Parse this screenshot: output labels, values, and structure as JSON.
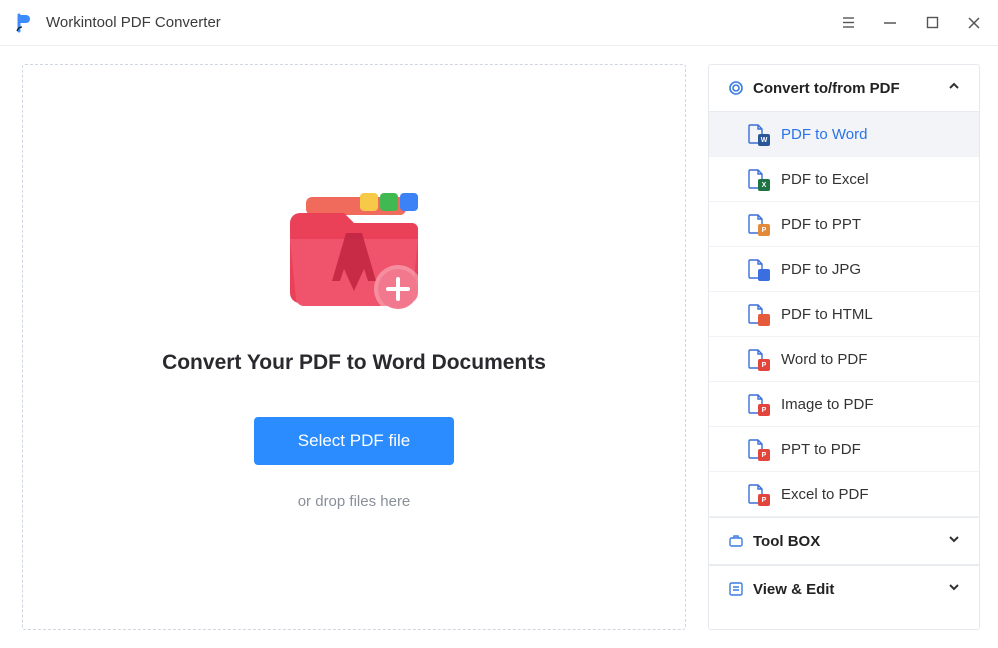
{
  "app": {
    "title": "Workintool PDF Converter"
  },
  "dropzone": {
    "headline": "Convert Your PDF to Word Documents",
    "select_button": "Select PDF file",
    "hint": "or drop files here"
  },
  "sidebar": {
    "sections": [
      {
        "title": "Convert to/from PDF",
        "expanded": true
      },
      {
        "title": "Tool BOX",
        "expanded": false
      },
      {
        "title": "View & Edit",
        "expanded": false
      }
    ],
    "convert_items": [
      {
        "label": "PDF to Word",
        "badge": "W",
        "badgeClass": "badge-word",
        "active": true
      },
      {
        "label": "PDF to Excel",
        "badge": "X",
        "badgeClass": "badge-excel",
        "active": false
      },
      {
        "label": "PDF to PPT",
        "badge": "P",
        "badgeClass": "badge-ppt",
        "active": false
      },
      {
        "label": "PDF to JPG",
        "badge": "",
        "badgeClass": "badge-jpg",
        "active": false
      },
      {
        "label": "PDF to HTML",
        "badge": "",
        "badgeClass": "badge-html",
        "active": false
      },
      {
        "label": "Word to PDF",
        "badge": "P",
        "badgeClass": "badge-pdf",
        "active": false
      },
      {
        "label": "Image to PDF",
        "badge": "P",
        "badgeClass": "badge-pdf",
        "active": false
      },
      {
        "label": "PPT to PDF",
        "badge": "P",
        "badgeClass": "badge-pdf",
        "active": false
      },
      {
        "label": "Excel to PDF",
        "badge": "P",
        "badgeClass": "badge-pdf",
        "active": false
      }
    ]
  },
  "colors": {
    "primary": "#2a8cff",
    "accent_red": "#ea4159"
  }
}
